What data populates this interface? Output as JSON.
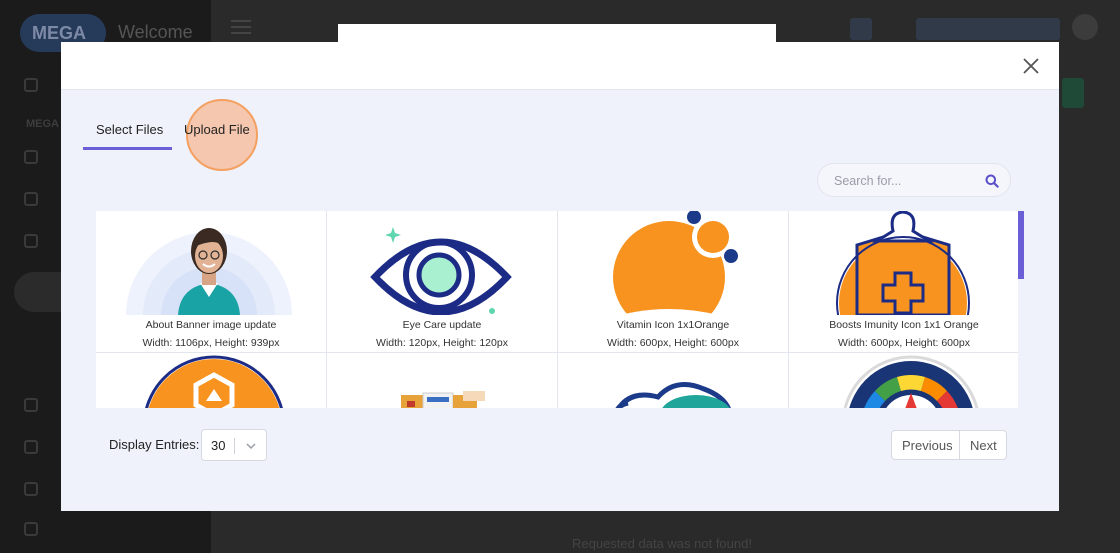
{
  "background": {
    "logo_text": "MEGA",
    "welcome_text": "Welcome",
    "side_section": "MEGA",
    "bottom_message": "Requested data was not found!"
  },
  "modal": {
    "tabs": [
      {
        "label": "Select Files",
        "active": true
      },
      {
        "label": "Upload File",
        "active": false
      }
    ],
    "search": {
      "placeholder": "Search for...",
      "value": ""
    },
    "files": [
      {
        "name": "About Banner image update",
        "size": "Width: 1106px, Height: 939px",
        "icon": "doctor-photo"
      },
      {
        "name": "Eye Care update",
        "size": "Width: 120px, Height: 120px",
        "icon": "eye-icon"
      },
      {
        "name": "Vitamin Icon 1x1Orange",
        "size": "Width: 600px, Height: 600px",
        "icon": "vitamin-icon"
      },
      {
        "name": "Boosts Imunity Icon 1x1 Orange",
        "size": "Width: 600px, Height: 600px",
        "icon": "immunity-shield-icon"
      },
      {
        "name": "",
        "size": "",
        "icon": "molecule-icon"
      },
      {
        "name": "",
        "size": "",
        "icon": "medicine-boxes"
      },
      {
        "name": "",
        "size": "",
        "icon": "cloud-icon"
      },
      {
        "name": "",
        "size": "",
        "icon": "gauge-icon"
      }
    ],
    "footer": {
      "entries_label": "Display Entries:",
      "entries_value": "30",
      "prev_label": "Previous",
      "next_label": "Next"
    }
  },
  "colors": {
    "accent": "#6a5fd6",
    "brand_orange": "#f7931e",
    "eye_navy": "#1c2c86",
    "highlight": "#f8b184"
  }
}
